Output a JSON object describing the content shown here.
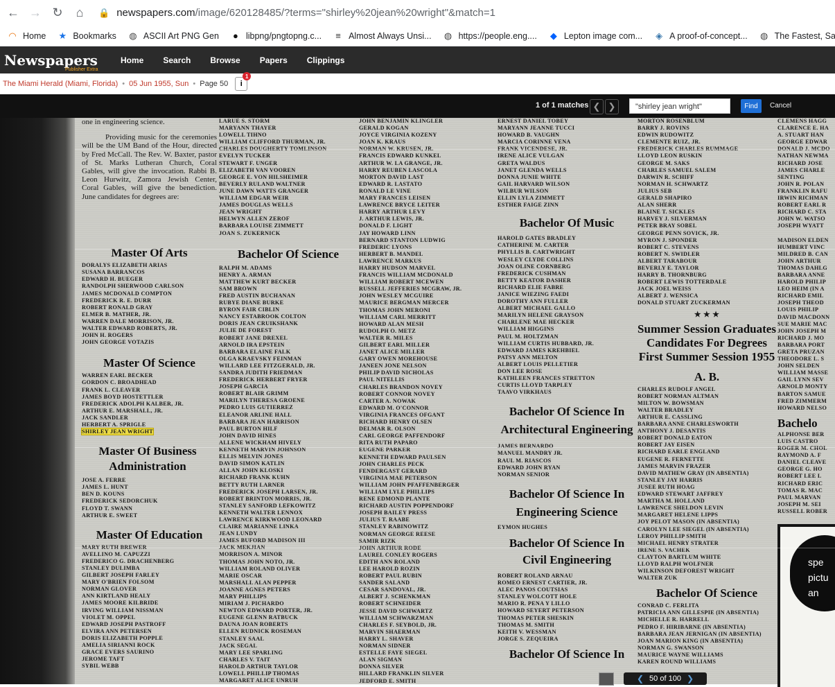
{
  "browser": {
    "url_host": "newspapers.com",
    "url_path": "/image/620128485/?terms=\"shirley%20jean%20wright\"&match=1",
    "bookmarks": [
      "Home",
      "Bookmarks",
      "ASCII Art PNG Gen",
      "libpng/pngtopng.c...",
      "Almost Always Unsi...",
      "https://people.eng....",
      "Lepton image com...",
      "A proof-of-concept...",
      "The Fastest, Safest..."
    ]
  },
  "site": {
    "logo": "Newspapers",
    "logo_sub": "Publisher Extra",
    "nav": [
      "Home",
      "Search",
      "Browse",
      "Papers",
      "Clippings"
    ]
  },
  "info": {
    "publication": "The Miami Herald (Miami, Florida)",
    "date": "05 Jun 1955, Sun",
    "page": "Page 50",
    "notif_count": "1"
  },
  "search": {
    "matches": "1 of 1 matches",
    "query": "\"shirley jean wright\"",
    "find_label": "Find",
    "cancel_label": "Cancel"
  },
  "pager": {
    "page": "50",
    "of": "of 100"
  },
  "newspaper": {
    "col1_intro": "one in engineering science.",
    "col1_text": "Providing music for the ceremonies will be the UM Band of the Hour, directed by Fred McCall. The Rev. W. Baxter, pastor of St. Marks Lutheran Church, Coral Gables, will give the invocation. Rabbi B. Leon Hurwitz, Zamora Jewish Center, Coral Gables, will give the benediction. June candidates for degrees are:",
    "h_arts": "Master Of Arts",
    "arts": [
      "DORALYS ELIZABETH ARIAS",
      "SUSANA BARRANCOS",
      "EDWARD H. BUEGER",
      "RANDOLPH SHERWOOD CARLSON",
      "JAMES McDONALD COMPTON",
      "FREDERICK R. E. DURR",
      "ROBERT RONALD GRAY",
      "ELMER B. MATHER, JR.",
      "WARREN DALE MORRISON, JR.",
      "WALTER EDWARD ROBERTS, JR.",
      "JOHN H. ROGERS",
      "JOHN GEORGE VOTAZIS"
    ],
    "h_science": "Master Of Science",
    "science": [
      "WARREN EARL BECKER",
      "GORDON C. BROADHEAD",
      "FRANK L. CLEAVER",
      "JAMES BOYD HOSTETTLER",
      "FREDERICK ADOLPH KALBER, JR.",
      "ARTHUR E. MARSHALL, JR.",
      "JACK SANDLER",
      "HERBERT A. SPRIGLE"
    ],
    "highlight": "SHIRLEY JEAN WRIGHT",
    "h_business": "Master Of Business Administration",
    "business": [
      "JOSE A. FERRE",
      "JAMES L. HUNT",
      "BEN D. KOUNS",
      "FREDERICK SEDORCHUK",
      "FLOYD T. SWANN",
      "ARTHUR E. SWEET"
    ],
    "h_education": "Master Of Education",
    "education": [
      "MARY RUTH BREWER",
      "AVELLINO M. CAPUZZI",
      "FREDERICO G. DRACHENBERG",
      "STANLEY DULIMBA",
      "GILBERT JOSEPH FARLEY",
      "MARY O'BRIEN FOLSOM",
      "NORMAN GLOVER",
      "ANN KIRTLAND HEALY",
      "JAMES MOORE KILBRIDE",
      "IRVING WILLIAM NISSMAN",
      "VIOLET M. OPPEL",
      "EDWARD JOSEPH PASTROFF",
      "ELVIRA ANN PETERSEN",
      "DORIS ELIZABETH POPPLE",
      "AMELIA SIRIANNI ROCK",
      "GRACE EVERS SAURINO",
      "JEROME TAFT",
      "SYBIL WEBB"
    ],
    "col2_top": [
      "LARUE S. STORM",
      "MARYANN THAYER",
      "LOWELL TIHNO",
      "WILLIAM CLIFFORD THURMAN, JR.",
      "CHARLES DOUGHERTY TOMLINSON",
      "EVELYN TUCKER",
      "STEWART F. UNGER",
      "ELIZABETH VAN VOOREN",
      "GEORGE E. VON HILSHEIMER",
      "BEVERLY RULAND WALTNER",
      "JUNE DAWN WATTS GRANGER",
      "WILLIAM EDGAR WEIR",
      "JAMES DOUGLAS WELLS",
      "JEAN WRIGHT",
      "HELWYN ALLEN ZEROF",
      "BARBARA LOUISE ZIMMETT",
      "JOAN S. ZUKERNICK"
    ],
    "h_bsci": "Bachelor Of Science",
    "col2": [
      "RALPH M. ADAMS",
      "HENRY A. ARMAN",
      "MATTHEW KURT BECKER",
      "SAM BROWN",
      "FRED AUSTIN BUCHANAN",
      "RUBYE DIANE BURKE",
      "BYRON FAIR CIBLIN",
      "NANCY ESTABROOK COLTON",
      "DORIS JEAN CRUIKSHANK",
      "JULIE DE FOREST",
      "ROBERT JANE DREXEL",
      "ARNOLD IRA EPSTEIN",
      "BARBARA ELAINE FALK",
      "OLGA KRAEVSKY FEINMAN",
      "WILLARD LEE FITZGERALD, JR.",
      "SANDRA JUDITH FRIEDMAN",
      "FREDERICK HERBERT FRYER",
      "JOSEPH GARCIA",
      "ROBERT BLAIR GRIMM",
      "MARILYN THERESA GROENE",
      "PEDRO LUIS GUTIERREZ",
      "ELEANOR ARLINE HALL",
      "BARBARA JEAN HARRISON",
      "PAUL BURTON HILF",
      "JOHN DAVID HINES",
      "ALLENE WICKHAM HIVELY",
      "KENNETH MARVIN JOHNSON",
      "ELLIS MELVIN JONES",
      "DAVID SIMON KATLIN",
      "ALLAN JOHN KLOSKI",
      "RICHARD FRANK KUHN",
      "BETTY RUTH LARNER",
      "FREDERICK JOSEPH LARSEN, JR.",
      "ROBERT BRINTON MORRIS, JR.",
      "STANLEY SANFORD LEFKOWITZ",
      "KENNETH WALTER LENNOX",
      "LAWRENCE KIRKWOOD LEONARD",
      "CLAIRE MARIANNE LINKA",
      "JEAN LUNDY",
      "JAMES BUFORD MADISON III",
      "JACK MEKJIAN",
      "MORRISON A. MINOR",
      "THOMAS JOHN NOTO, JR.",
      "WILLIAM ROLAND OLIVER",
      "MARIE OSCAR",
      "MARSHALL ALAN PEPPER",
      "JOANNE AGNES PETERS",
      "MARY PHILLIPS",
      "MIRIAM J. PICHARDO",
      "NEWTON EDWARD PORTER, JR.",
      "EUGENE GLENN RATBUCK",
      "DAUNA JOAN ROBERTS",
      "ELLEN RUDNICK ROSEMAN",
      "STANLEY SAAL",
      "JACK SEGAL",
      "MARY LEE SPARLING",
      "CHARLES V. TAIT",
      "HAROLD ARTHUR TAYLOR",
      "LOWELL PHILLIP THOMAS",
      "MARGARET ALICE UNRUH"
    ],
    "col3": [
      "JOHN BENJAMIN KLINGLER",
      "GERALD KOGAN",
      "JOYCE VIRGINIA KOZENY",
      "JOAN K. KRAUS",
      "NORMAN W. KRUSEN, JR.",
      "FRANCIS EDWARD KUNKEL",
      "ARTHUR W. LA GRANGE, JR.",
      "HARRY REUBEN LASCOLA",
      "MORTON DAVID LAST",
      "EDWARD R. LASTATO",
      "RONALD LE VINE",
      "MARY FRANCES LEISEN",
      "LAWRENCE BRYCE LEITER",
      "HARRY ARTHUR LEVY",
      "J. ARTHUR LEWIS, JR.",
      "DONALD F. LIGHT",
      "JAY HOWARD LINN",
      "BERNARD STANTON LUDWIG",
      "FREDERIC LYONS",
      "HERBERT B. MANDEL",
      "LAWRENCE MARKUS",
      "HARRY HUDSON MARVEL",
      "FRANCIS WILLIAM McDONALD",
      "WILLIAM ROBERT McEWEN",
      "RUSSELL JEFFERIES McGRAW, JR.",
      "JOHN WESLEY McGUIRE",
      "MAURICE BERGMAN MERCER",
      "THOMAS JOHN MERONI",
      "WILLIAM CARL MERRITT",
      "HOWARD ALAN MESH",
      "RUDOLPH O. METZ",
      "WALTER R. MILES",
      "GILBERT EARL MILLER",
      "JANET ALICE MILLER",
      "GARY OWEN MOREHOUSE",
      "JANEEN JONE NELSON",
      "PHILIP DAVID NICHOLAS",
      "PAUL NITELLIS",
      "CHARLES BRANDON NOVEY",
      "ROBERT CONNOR NOVEY",
      "CARTER A. NOWAK",
      "EDWARD M. O'CONNOR",
      "VIRGINIA FRANCES OFGANT",
      "RICHARD HENRY OLSEN",
      "DELMAR R. OLSON",
      "CARL GEORGE PAFFENDORF",
      "RITA RUTH PAPARO",
      "EUGENE PARKER",
      "KENNETH EDWARD PAULSEN",
      "JOHN CHARLES PECK",
      "FENDERGAST GERARD",
      "VIRGINIA MAE PETERSON",
      "WILLIAM JOHN PFAFFENBERGER",
      "WILLIAM LYLE PHILLIPS",
      "RENE EDMOND PLANTE",
      "RICHARD AUSTIN POPPENDORF",
      "JOSEPH BAILEY PRESS",
      "JULIUS T. RAABE",
      "STANLEY RABINOWITZ",
      "NORMAN GEORGE REESE",
      "SAMIR RIZK",
      "JOHN ARTHUR RODE",
      "LAUREL CONLEY ROGERS",
      "EDITH ANN ROLAND",
      "LEE HAROLD ROZIN",
      "ROBERT PAUL RUBIN",
      "SANDER SALAND",
      "CESAR SANDOVAL, JR.",
      "ALBERT J. SCHENKMAN",
      "ROBERT SCHNEIDER",
      "JESSE DAVID SCHWARTZ",
      "WILLIAM SCHWARZMAN",
      "CHARLES F. SEYBOLD, JR.",
      "MARVIN SHAERMAN",
      "HARRY L. SHAVER",
      "NORMAN SIDNER",
      "ESTELLE FAYE SIEGEL",
      "ALAN SIGMAN",
      "DONNA SILVER",
      "HILLARD FRANKLIN SILVER",
      "JEDFORD E. SMITH"
    ],
    "col4_top": [
      "ERNEST DANIEL TOBEY",
      "MARYANN JEANNE TUCCI",
      "HOWARD B. VAUGHN",
      "MARCIA CORINNE VENA",
      "FRANK VICENDESE, JR.",
      "IRENE ALICE VULGAN",
      "GRETA WALDUS",
      "JANET GLENDA WELLS",
      "DONNA JUNIE WHITE",
      "GAIL HARVARD WILSON",
      "WILBUR WILSON",
      "ELLIN LYLA ZIMMETT",
      "ESTHER FAIGE ZINN"
    ],
    "h_music": "Bachelor Of Music",
    "music": [
      "HAROLD GATES BRADLEY",
      "CATHERINE M. CARTER",
      "PHYLLIS B. CARTWRIGHT",
      "WESLEY CLYDE COLLINS",
      "JOAN OLINE CORNBERG",
      "FREDERICK CUSHMAN",
      "BETTY KEATOR DASHER",
      "RICHARD ELIE FABRE",
      "JANICE WIEZING FAEDI",
      "DOROTHY ANN FULLER",
      "ALBERT MICHAEL GALLO",
      "MARILYN HELENE GRAYSON",
      "CHARLENE MAE HECKER",
      "WILLIAM HIGGINS",
      "PAUL M. HOLTZMAN",
      "WILLIAM CURTIS HUBBARD, JR.",
      "EDWARD JAMES KREHBIEL",
      "PATSY ANN MELTON",
      "ALBERT LOUIS PELLETIER",
      "DON LEE ROSE",
      "KATHLEEN FRANCES STRETTON",
      "CURTIS LLOYD TARPLEY",
      "TAAVO VIRKHAUS"
    ],
    "h_arch": "Bachelor Of Science In Architectural Engineering",
    "arch": [
      "JAMES BERNARDO",
      "MANUEL MANDRY JR.",
      "RAUL M. RIASCOS",
      "EDWARD JOHN RYAN",
      "NORMAN SENIOR"
    ],
    "h_eng": "Bachelor Of Science In Engineering Science",
    "eng": [
      "EYMON HUGHES"
    ],
    "h_civil": "Bachelor Of Science In Civil Engineering",
    "civil": [
      "ROBERT ROLAND ARNAU",
      "ROMEO ERNEST CARTIER, JR.",
      "ALEC PANOS COUTSIAS",
      "STANLEY WOLCOTT HOLE",
      "MARIO R. PENA Y LILLO",
      "HOWARD SEYERT PETERSON",
      "THOMAS PETER SHESKIN",
      "THOMAS M. SMITH",
      "KEITH V. WESSMAN",
      "JORGE S. ZEQUEIRA"
    ],
    "h_bsci2": "Bachelor Of Science In",
    "col5_top": [
      "MORTON ROSENBLUM",
      "BARRY J. ROVINS",
      "EDWIN RUDOWITZ",
      "CLEMENTE RUIZ, JR.",
      "FREDERICK CHARLES RUMMAGE",
      "LLOYD LEON RUSKIN",
      "GEORGE M. SAKS",
      "CHARLES SAMUEL SALEM",
      "DARWIN R. SCHIFF",
      "NORMAN H. SCHWARTZ",
      "JULIUS SEB",
      "GERALD SHAPIRO",
      "ALAN SHERR",
      "BLAINE T. SICKLES",
      "HARVEY J. SILVERMAN",
      "PETER BRAY SOBEL",
      "GEORGE PENN SOVICK, JR.",
      "MYRON J. SPONDER",
      "ROBERT C. STEVENS",
      "ROBERT N. SWIDLER",
      "ALBERT TARABOUR",
      "BEVERLY E. TAYLOR",
      "HARRY B. THORNBURG",
      "ROBERT LEWIS TOTTERDALE",
      "JACK JOEL WEISS",
      "ALBERT J. WENSICA",
      "DONALD STUART ZUCKERMAN"
    ],
    "stars": "★ ★ ★",
    "h_summer": "Summer Session Graduates Candidates For Degrees First Summer Session 1955",
    "h_ab": "A. B.",
    "ab": [
      "CHARLES RUDOLF ANGEL",
      "ROBERT NORMAN ALTMAN",
      "MILTON W. BOWSMAN",
      "WALTER BRADLEY",
      "ARTHUR E. CASSLING",
      "BARBARA ANNE CHARLESWORTH",
      "ANTHONY J. DeSANTIS",
      "ROBERT DONALD EATON",
      "ROBERT JAY EISEN",
      "RICHARD EARLE ENGLAND",
      "EUGENE R. FERNETTE",
      "JAMES MARVIN FRAZER",
      "DAVID MATHEW GRAY (in absentia)",
      "STANLEY JAY HARRIS",
      "JUSEE RUTH HOAG",
      "EDWARD STEWART JAFFREY",
      "MARTHA M. HOLLAND",
      "LAWRENCE SHELDON LEVIN",
      "MARGARET HELENE LIPPS",
      "JOY PELOT MASON (in absentia)",
      "CAROLYN LEE SIEGEL (in absentia)",
      "LeROY PHILLIP SMITH",
      "MICHAEL HENRY STRATER",
      "IRENE S. VACHEK",
      "CLAYTON BARTLUM WHITE",
      "LLOYD RALPH WOLFNER",
      "WILKINSON DEFOREST WRIGHT",
      "WALTER ZUK"
    ],
    "h_bsci3": "Bachelor Of Science",
    "bsci3": [
      "CONRAD C. FERLITA",
      "PATRICIA ANN GILLESPIE (in absentia)",
      "MICHELLE R. HARRELL",
      "PEDRO F. HIRIBARNE (in absentia)",
      "BARBARA JEAN JERNIGAN (in absentia)",
      "JOAN MARION KING (in absentia)",
      "NORMAN G. SWANSON",
      "MAURICE WAYNE WILLIAMS",
      "KAREN ROUND WILLIAMS"
    ],
    "col6": [
      "CLEMENS HAGG",
      "CLARENCE E. HA",
      "A. STUART HAN",
      "GEORGE EDWAR",
      "DONALD J. McDO",
      "NATHAN NEWMA",
      "RICHARD JOSE",
      "JAMES CHARLE",
      "senting",
      "JOHN R. POLAN",
      "FRANKLIN RAFU",
      "IRWIN RICHMAN",
      "ROBERT EARL R",
      "RICHARD C. STA",
      "JOHN W. WATSO",
      "JOSEPH WYATT",
      "",
      "MADISON ELDEN",
      "HUMBERT VINC",
      "MILDRED B. CAN",
      "JOHN ARTHUR",
      "THOMAS DAHLG",
      "BARBARA ANNE",
      "HAROLD PHILIP",
      "LEO HEIM (in a",
      "RICHARD EMIL",
      "JOSEPH THEOD",
      "LOUIS PHILIP",
      "DAVID MacDONN",
      "SUE MARIE MAC",
      "JOHN JOSEPH M",
      "RICHARD J. MO",
      "BARBARA PORT",
      "GRETA PRUZAN",
      "THEODORE L. S",
      "JOHN SELDEN",
      "WILLIAM MASSE",
      "GAIL LYNN SEV",
      "ARNOLD MONTY",
      "BARTON SAMUE",
      "FRED ZIMMERM",
      "HOWARD NELSO"
    ],
    "h_col6": "Bachelo",
    "col6b": [
      "ALPHONSE BER",
      "LUIS CASTRO",
      "ROGER M. CHOL",
      "RAYMOND A. F",
      "DANIEL CLEAVE",
      "GEORGE G. HO",
      "ROBERT LEE L",
      "RICHARD ERIC",
      "TOMAS R. MAC",
      "PAUL MARVAN",
      "JOSEPH M. SEI",
      "RUSSELL ROBER"
    ],
    "ad_text": [
      "spe",
      "pictu",
      "an"
    ]
  }
}
